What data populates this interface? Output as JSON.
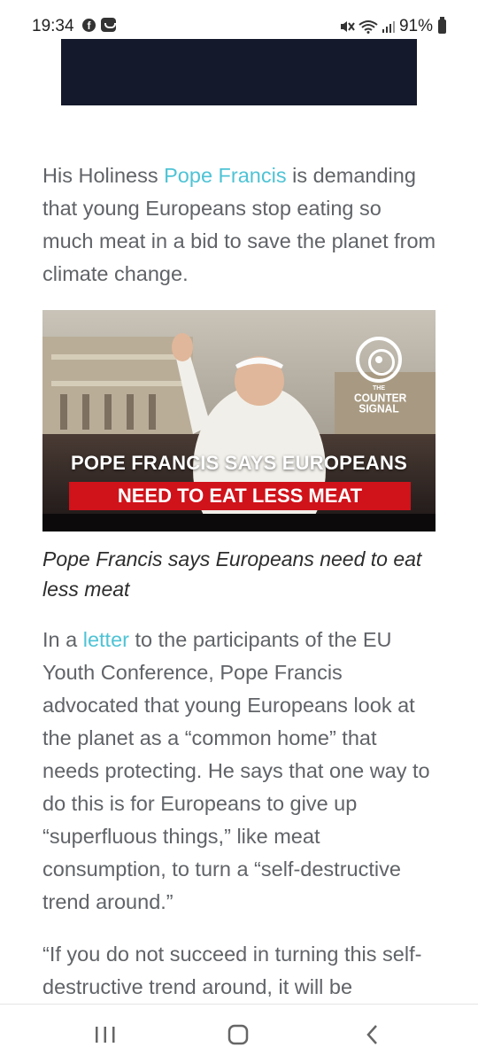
{
  "status_bar": {
    "time": "19:34",
    "battery": "91%",
    "left_icons": [
      "facebook-icon",
      "message-icon"
    ],
    "right_icons": [
      "mute-icon",
      "wifi-icon",
      "signal-icon",
      "battery-icon"
    ]
  },
  "article": {
    "para1": {
      "before": "His Holiness ",
      "link": "Pope Francis",
      "after": " is demanding that young Europeans stop eating so much meat in a bid to save the planet from climate change."
    },
    "image": {
      "headline_line1": "POPE FRANCIS SAYS EUROPEANS",
      "headline_line2": "NEED TO EAT LESS MEAT",
      "logo_small": "THE",
      "logo_line1": "COUNTER",
      "logo_line2": "SIGNAL"
    },
    "caption": "Pope Francis says Europeans need to eat less meat",
    "para2": {
      "before": "In a ",
      "link": "letter",
      "after": " to the participants of the EU Youth Conference, Pope Francis advocated that young Europeans look at the planet as a “common home” that needs protecting. He says that one way to do this is for Europeans to give up “superfluous things,” like meat consumption, to turn a “self-destructive trend around.”"
    },
    "para3": "“If you do not succeed in turning this self-destructive trend around, it will be"
  },
  "nav_bar": {
    "buttons": [
      "recent-apps",
      "home",
      "back"
    ]
  },
  "colors": {
    "link": "#4ec3d5",
    "text": "#606367",
    "banner": "#141a2b",
    "headline_red": "#d0121a"
  }
}
